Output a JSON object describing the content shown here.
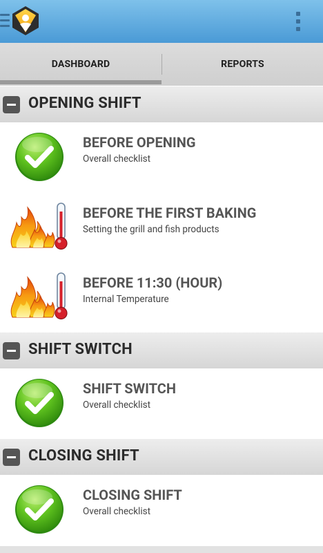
{
  "appbar": {
    "menu_icon": "hamburger-menu-icon",
    "logo_icon": "app-logo-icon",
    "overflow_icon": "more-vertical-icon",
    "color": "#4a9ad6"
  },
  "tabs": [
    {
      "label": "DASHBOARD",
      "selected": true
    },
    {
      "label": "REPORTS",
      "selected": false
    }
  ],
  "sections": [
    {
      "title": "OPENING SHIFT",
      "icon": "collapse-minus-icon",
      "items": [
        {
          "title": "BEFORE OPENING",
          "subtitle": "Overall checklist",
          "icon": "green-checkmark-icon"
        },
        {
          "title": "BEFORE THE FIRST BAKING",
          "subtitle": "Setting the grill and fish products",
          "icon": "fire-thermometer-icon"
        },
        {
          "title": "BEFORE 11:30 (HOUR)",
          "subtitle": "Internal Temperature",
          "icon": "fire-thermometer-icon"
        }
      ]
    },
    {
      "title": "SHIFT SWITCH",
      "icon": "collapse-minus-icon",
      "items": [
        {
          "title": "SHIFT SWITCH",
          "subtitle": "Overall checklist",
          "icon": "green-checkmark-icon"
        }
      ]
    },
    {
      "title": "CLOSING SHIFT",
      "icon": "collapse-minus-icon",
      "items": [
        {
          "title": "CLOSING SHIFT",
          "subtitle": "Overall checklist",
          "icon": "green-checkmark-icon"
        }
      ]
    }
  ]
}
